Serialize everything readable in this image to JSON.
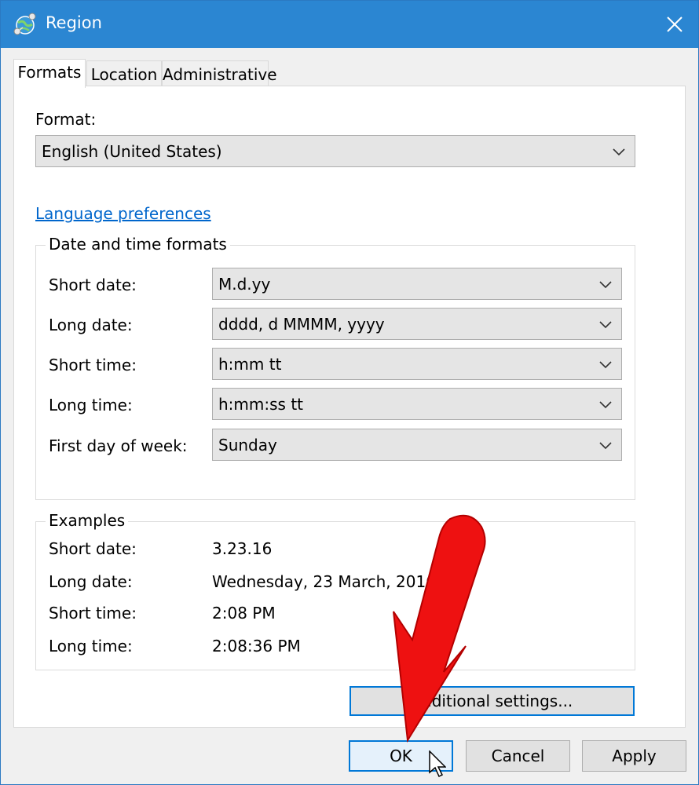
{
  "window": {
    "title": "Region",
    "icon": "globe-network-icon",
    "close_icon": "close-icon"
  },
  "tabs": [
    {
      "label": "Formats",
      "active": true
    },
    {
      "label": "Location",
      "active": false
    },
    {
      "label": "Administrative",
      "active": false
    }
  ],
  "format": {
    "label": "Format:",
    "value": "English (United States)"
  },
  "language_link": "Language preferences",
  "datetime": {
    "legend": "Date and time formats",
    "rows": [
      {
        "label": "Short date:",
        "value": "M.d.yy"
      },
      {
        "label": "Long date:",
        "value": "dddd, d MMMM, yyyy"
      },
      {
        "label": "Short time:",
        "value": "h:mm tt"
      },
      {
        "label": "Long time:",
        "value": "h:mm:ss tt"
      },
      {
        "label": "First day of week:",
        "value": "Sunday"
      }
    ]
  },
  "examples": {
    "legend": "Examples",
    "rows": [
      {
        "label": "Short date:",
        "value": "3.23.16"
      },
      {
        "label": "Long date:",
        "value": "Wednesday, 23 March, 2016"
      },
      {
        "label": "Short time:",
        "value": "2:08 PM"
      },
      {
        "label": "Long time:",
        "value": "2:08:36 PM"
      }
    ]
  },
  "additional_settings": "Additional settings...",
  "buttons": {
    "ok": "OK",
    "cancel": "Cancel",
    "apply": "Apply"
  },
  "annotation": {
    "arrow_color": "#ee1111",
    "arrow_icon": "red-arrow-annotation"
  },
  "accent_color": "#2b86d2"
}
